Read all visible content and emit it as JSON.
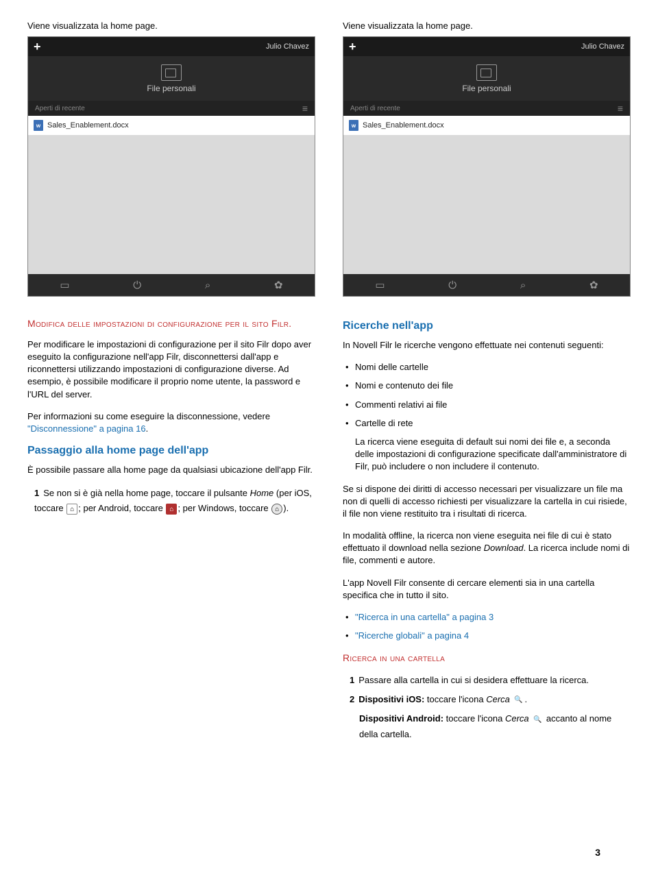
{
  "screenshotCaption1": "Viene visualizzata la home page.",
  "screenshotCaption2": "Viene visualizzata la home page.",
  "mock": {
    "user": "Julio Chavez",
    "headerLabel": "File personali",
    "subheader": "Aperti di recente",
    "fileName": "Sales_Enablement.docx",
    "docIconLetter": "w"
  },
  "left": {
    "smallcaps": "Modifica delle impostazioni di configurazione per il sito Filr.",
    "p1": "Per modificare le impostazioni di configurazione per il sito Filr dopo aver eseguito la configurazione nell'app Filr, disconnettersi dall'app e riconnettersi utilizzando impostazioni di configurazione diverse. Ad esempio, è possibile modificare il proprio nome utente, la password e l'URL del server.",
    "p2a": "Per informazioni su come eseguire la disconnessione, vedere ",
    "p2link": "\"Disconnessione\" a pagina 16",
    "p2b": ".",
    "h2": "Passaggio alla home page dell'app",
    "p3": "È possibile passare alla home page da qualsiasi ubicazione dell'app Filr.",
    "step1a": "Se non si è già nella home page, toccare il pulsante ",
    "step1home": "Home",
    "step1b": " (per iOS, toccare ",
    "step1c": "; per Android, toccare ",
    "step1d": "; per Windows, toccare ",
    "step1e": ")."
  },
  "right": {
    "h2": "Ricerche nell'app",
    "p1": "In Novell Filr le ricerche vengono effettuate nei contenuti seguenti:",
    "bullets": [
      "Nomi delle cartelle",
      "Nomi e contenuto dei file",
      "Commenti relativi ai file",
      "Cartelle di rete"
    ],
    "bulletExtra": "La ricerca viene eseguita di default sui nomi dei file e, a seconda delle impostazioni di configurazione specificate dall'amministratore di Filr, può includere o non includere il contenuto.",
    "p2": "Se si dispone dei diritti di accesso necessari per visualizzare un file ma non di quelli di accesso richiesti per visualizzare la cartella in cui risiede, il file non viene restituito tra i risultati di ricerca.",
    "p3a": "In modalità offline, la ricerca non viene eseguita nei file di cui è stato effettuato il download nella sezione ",
    "p3i": "Download",
    "p3b": ". La ricerca include nomi di file, commenti e autore.",
    "p4": "L'app Novell Filr consente di cercare elementi sia in una cartella specifica che in tutto il sito.",
    "link1": "\"Ricerca in una cartella\" a pagina 3",
    "link2": "\"Ricerche globali\" a pagina 4",
    "smallcaps": "Ricerca in una cartella",
    "step1": "Passare alla cartella in cui si desidera effettuare la ricerca.",
    "step2a": "Dispositivi iOS:",
    "step2b": " toccare l'icona ",
    "step2i": "Cerca",
    "step2c": ".",
    "step3a": "Dispositivi Android:",
    "step3b": " toccare l'icona ",
    "step3i": "Cerca",
    "step3c": " accanto al nome della cartella."
  },
  "pageNumber": "3"
}
